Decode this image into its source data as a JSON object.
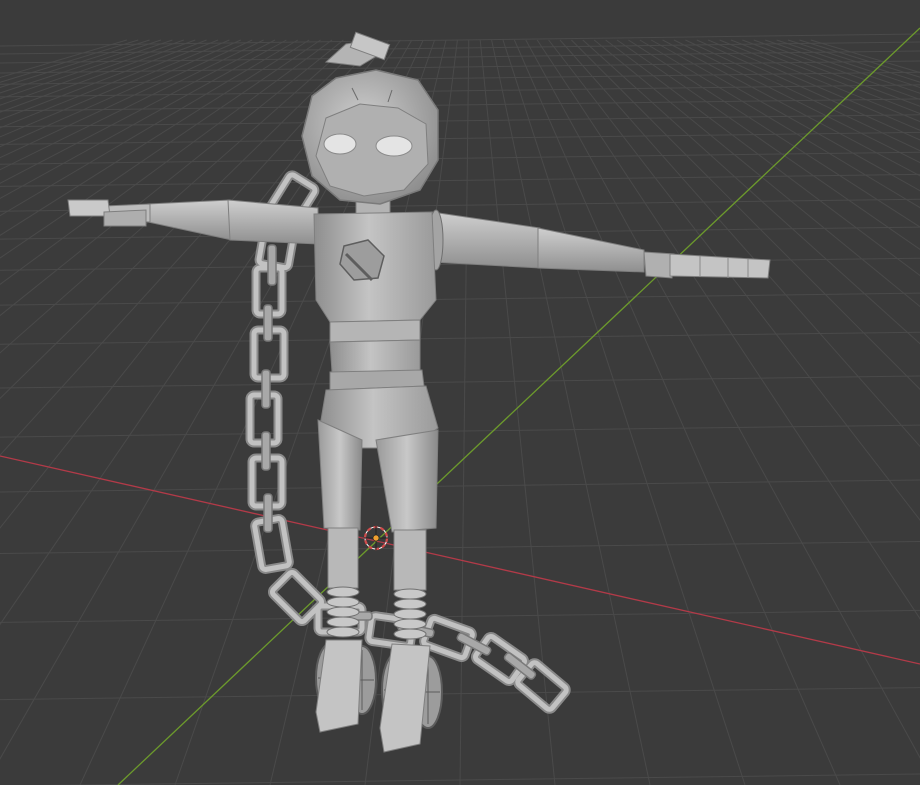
{
  "viewport": {
    "name": "3D Viewport",
    "background": "#3b3b3b",
    "grid_color": "#4a4a4a",
    "x_axis_color": "#b23a48",
    "y_axis_color": "#6c9a2c"
  },
  "model": {
    "material_color": "#b9b9b9",
    "shadow_color": "#7d7d7d",
    "highlight_color": "#d8d8d8",
    "eye_color": "#e6e6e6"
  },
  "cursor_3d": {
    "outer_color": "#d24b4b",
    "inner_color": "#ffffff"
  },
  "origin_point": {
    "color": "#f0a030"
  }
}
